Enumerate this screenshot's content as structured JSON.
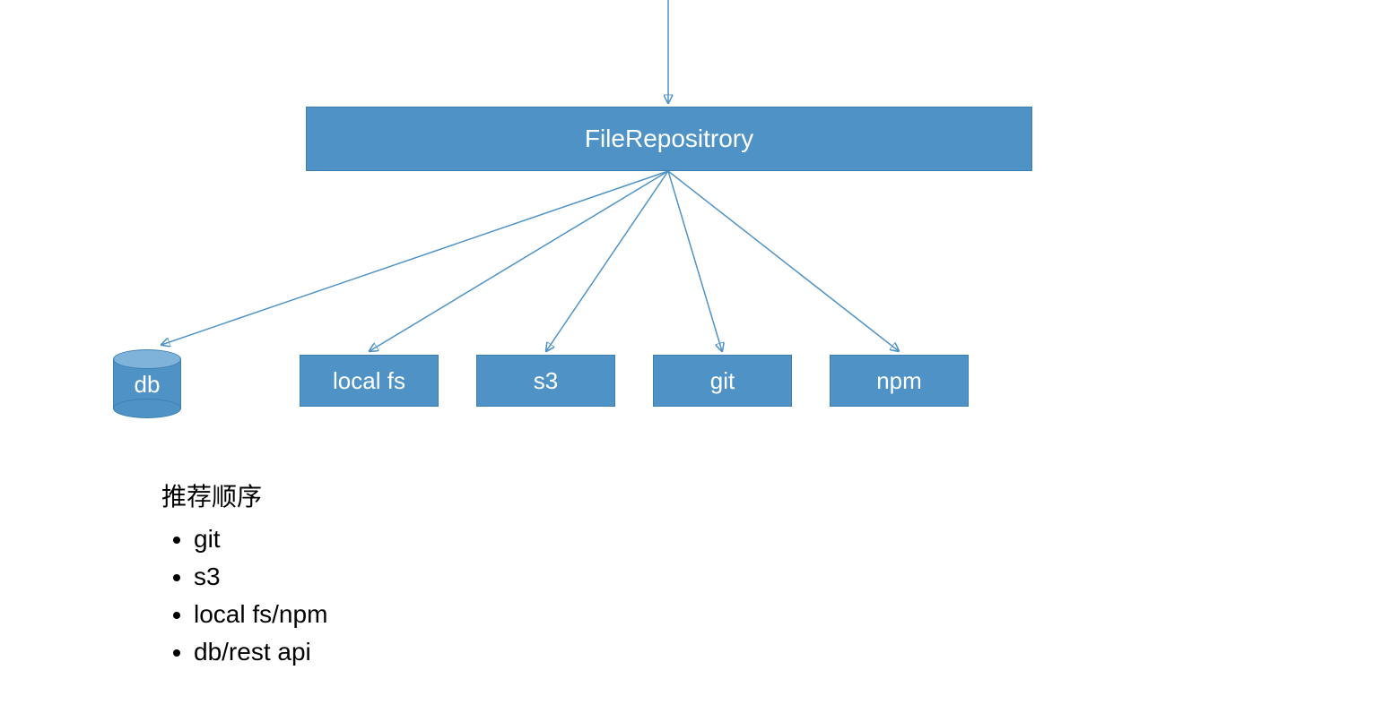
{
  "main": {
    "label": "FileRepositrory"
  },
  "children": {
    "db": {
      "label": "db"
    },
    "localfs": {
      "label": "local fs"
    },
    "s3": {
      "label": "s3"
    },
    "git": {
      "label": "git"
    },
    "npm": {
      "label": "npm"
    }
  },
  "notes": {
    "title": "推荐顺序",
    "items": [
      "git",
      "s3",
      "local fs/npm",
      "db/rest api"
    ]
  },
  "colors": {
    "box_fill": "#4f93c6",
    "box_border": "#3d7fb0",
    "line": "#4f93c6"
  }
}
